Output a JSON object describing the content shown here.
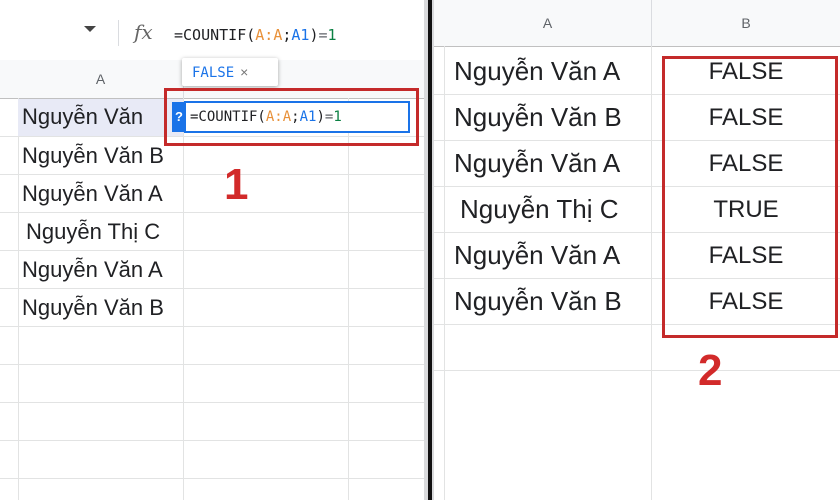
{
  "formula_bar": {
    "fx_icon": "fx-icon",
    "formula_func": "=COUNTIF(",
    "formula_range1": "A:A",
    "formula_sep": ";",
    "formula_range2": "A1",
    "formula_close": ")",
    "formula_eq": "=",
    "formula_num": "1"
  },
  "left_sheet": {
    "col_a_header": "A",
    "rows": [
      "Nguyễn Văn",
      "Nguyễn Văn B",
      "Nguyễn Văn A",
      "Nguyễn Thị C",
      "Nguyễn Văn A",
      "Nguyễn Văn B"
    ],
    "tooltip_value": "FALSE",
    "tooltip_close": "×",
    "help_label": "?",
    "callout_number": "1"
  },
  "right_sheet": {
    "col_a_header": "A",
    "col_b_header": "B",
    "names": [
      "Nguyễn Văn A",
      "Nguyễn Văn B",
      "Nguyễn Văn A",
      "Nguyễn Thị C",
      "Nguyễn Văn A",
      "Nguyễn Văn B"
    ],
    "results": [
      "FALSE",
      "FALSE",
      "FALSE",
      "TRUE",
      "FALSE",
      "FALSE"
    ],
    "callout_number": "2"
  },
  "colors": {
    "highlight_box": "#c42a2a",
    "editor_border": "#1a73e8",
    "range_orange": "#e8913a",
    "range_blue": "#1a73e8"
  }
}
